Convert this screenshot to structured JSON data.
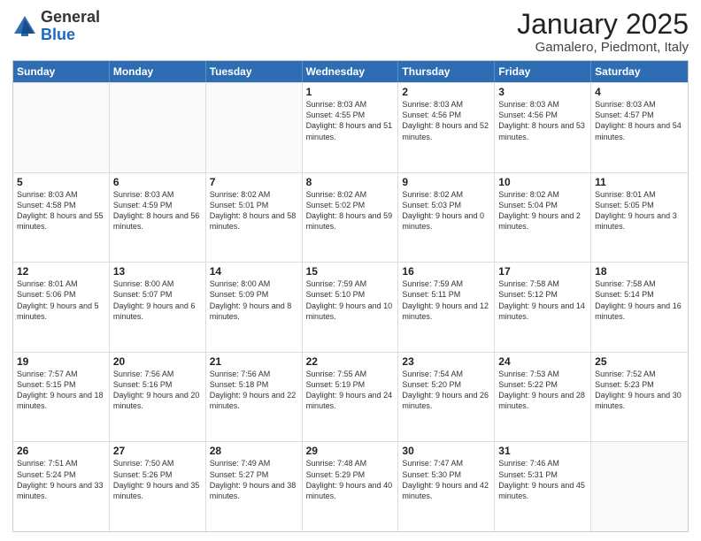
{
  "logo": {
    "general": "General",
    "blue": "Blue"
  },
  "title": "January 2025",
  "subtitle": "Gamalero, Piedmont, Italy",
  "header": {
    "days": [
      "Sunday",
      "Monday",
      "Tuesday",
      "Wednesday",
      "Thursday",
      "Friday",
      "Saturday"
    ]
  },
  "weeks": [
    [
      {
        "day": "",
        "data": ""
      },
      {
        "day": "",
        "data": ""
      },
      {
        "day": "",
        "data": ""
      },
      {
        "day": "1",
        "data": "Sunrise: 8:03 AM\nSunset: 4:55 PM\nDaylight: 8 hours and 51 minutes."
      },
      {
        "day": "2",
        "data": "Sunrise: 8:03 AM\nSunset: 4:56 PM\nDaylight: 8 hours and 52 minutes."
      },
      {
        "day": "3",
        "data": "Sunrise: 8:03 AM\nSunset: 4:56 PM\nDaylight: 8 hours and 53 minutes."
      },
      {
        "day": "4",
        "data": "Sunrise: 8:03 AM\nSunset: 4:57 PM\nDaylight: 8 hours and 54 minutes."
      }
    ],
    [
      {
        "day": "5",
        "data": "Sunrise: 8:03 AM\nSunset: 4:58 PM\nDaylight: 8 hours and 55 minutes."
      },
      {
        "day": "6",
        "data": "Sunrise: 8:03 AM\nSunset: 4:59 PM\nDaylight: 8 hours and 56 minutes."
      },
      {
        "day": "7",
        "data": "Sunrise: 8:02 AM\nSunset: 5:01 PM\nDaylight: 8 hours and 58 minutes."
      },
      {
        "day": "8",
        "data": "Sunrise: 8:02 AM\nSunset: 5:02 PM\nDaylight: 8 hours and 59 minutes."
      },
      {
        "day": "9",
        "data": "Sunrise: 8:02 AM\nSunset: 5:03 PM\nDaylight: 9 hours and 0 minutes."
      },
      {
        "day": "10",
        "data": "Sunrise: 8:02 AM\nSunset: 5:04 PM\nDaylight: 9 hours and 2 minutes."
      },
      {
        "day": "11",
        "data": "Sunrise: 8:01 AM\nSunset: 5:05 PM\nDaylight: 9 hours and 3 minutes."
      }
    ],
    [
      {
        "day": "12",
        "data": "Sunrise: 8:01 AM\nSunset: 5:06 PM\nDaylight: 9 hours and 5 minutes."
      },
      {
        "day": "13",
        "data": "Sunrise: 8:00 AM\nSunset: 5:07 PM\nDaylight: 9 hours and 6 minutes."
      },
      {
        "day": "14",
        "data": "Sunrise: 8:00 AM\nSunset: 5:09 PM\nDaylight: 9 hours and 8 minutes."
      },
      {
        "day": "15",
        "data": "Sunrise: 7:59 AM\nSunset: 5:10 PM\nDaylight: 9 hours and 10 minutes."
      },
      {
        "day": "16",
        "data": "Sunrise: 7:59 AM\nSunset: 5:11 PM\nDaylight: 9 hours and 12 minutes."
      },
      {
        "day": "17",
        "data": "Sunrise: 7:58 AM\nSunset: 5:12 PM\nDaylight: 9 hours and 14 minutes."
      },
      {
        "day": "18",
        "data": "Sunrise: 7:58 AM\nSunset: 5:14 PM\nDaylight: 9 hours and 16 minutes."
      }
    ],
    [
      {
        "day": "19",
        "data": "Sunrise: 7:57 AM\nSunset: 5:15 PM\nDaylight: 9 hours and 18 minutes."
      },
      {
        "day": "20",
        "data": "Sunrise: 7:56 AM\nSunset: 5:16 PM\nDaylight: 9 hours and 20 minutes."
      },
      {
        "day": "21",
        "data": "Sunrise: 7:56 AM\nSunset: 5:18 PM\nDaylight: 9 hours and 22 minutes."
      },
      {
        "day": "22",
        "data": "Sunrise: 7:55 AM\nSunset: 5:19 PM\nDaylight: 9 hours and 24 minutes."
      },
      {
        "day": "23",
        "data": "Sunrise: 7:54 AM\nSunset: 5:20 PM\nDaylight: 9 hours and 26 minutes."
      },
      {
        "day": "24",
        "data": "Sunrise: 7:53 AM\nSunset: 5:22 PM\nDaylight: 9 hours and 28 minutes."
      },
      {
        "day": "25",
        "data": "Sunrise: 7:52 AM\nSunset: 5:23 PM\nDaylight: 9 hours and 30 minutes."
      }
    ],
    [
      {
        "day": "26",
        "data": "Sunrise: 7:51 AM\nSunset: 5:24 PM\nDaylight: 9 hours and 33 minutes."
      },
      {
        "day": "27",
        "data": "Sunrise: 7:50 AM\nSunset: 5:26 PM\nDaylight: 9 hours and 35 minutes."
      },
      {
        "day": "28",
        "data": "Sunrise: 7:49 AM\nSunset: 5:27 PM\nDaylight: 9 hours and 38 minutes."
      },
      {
        "day": "29",
        "data": "Sunrise: 7:48 AM\nSunset: 5:29 PM\nDaylight: 9 hours and 40 minutes."
      },
      {
        "day": "30",
        "data": "Sunrise: 7:47 AM\nSunset: 5:30 PM\nDaylight: 9 hours and 42 minutes."
      },
      {
        "day": "31",
        "data": "Sunrise: 7:46 AM\nSunset: 5:31 PM\nDaylight: 9 hours and 45 minutes."
      },
      {
        "day": "",
        "data": ""
      }
    ]
  ]
}
